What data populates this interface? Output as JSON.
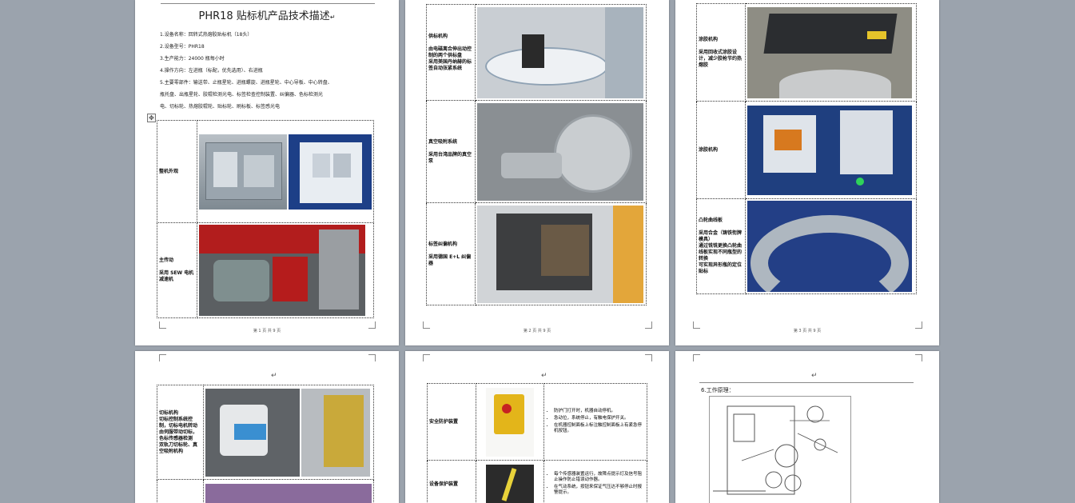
{
  "doc": {
    "title": "PHR18 贴标机产品技术描述",
    "return_mark": "↵",
    "spec_lines": [
      "1.设备名称：回转式热熔胶贴标机（18头）",
      "2.设备型号：PHR18",
      "3.生产能力：24000 瓶每小时",
      "4.操作方向：左进瓶（标配，优先选用）、右进瓶",
      "5.主要零部件：输送带、止瓶星轮、进瓶螺旋、进瓶星轮、中心导板、中心转盘、",
      "瓶托盘、出瓶星轮、胶辊检测光电、标签检查控制装置、纠偏器、色标检测光",
      "电、切标轮、热熔胶辊轮、贴标轮、刷标板、标签感光电"
    ],
    "sections": {
      "p1_r1": "整机外观",
      "p1_r2": "主传动\n\n采用 SEW 电机减速机",
      "p2_r1": "供标机构\n\n由电磁离合伸出动控制的两个供标盘\n采用美国丹纳赫的标签自动张紧系统",
      "p2_r2": "真空吸附系统\n\n采用台湾品牌的真空泵",
      "p2_r3": "标签纠偏机构\n\n采用德国 E+L 纠偏器",
      "p3_r1": "涂胶机构\n\n采用回收式涂胶设计，减少胶枪节约热熔胶",
      "p3_r2": "涂胶机构",
      "p3_r3": "凸轮曲线板\n\n采用合金（铸铁衔牌模具）\n通过铣铣更换凸轮曲线板实现不同瓶型的转换\n可实现异形瓶的定位贴标",
      "p4_r1": "切标机构\n切标控制系统控制，切标电机转动由伺服带动切标，色标传感器检测\n双轨刀切标轮、真空吸附机构",
      "p5_r1": "安全防护装置",
      "p5_r2": "设备保护装置",
      "p6_heading": "6.工作原理："
    },
    "p5_bullets_1": [
      "防护门打开时，机器自动停机。",
      "急动位，系统停止，有触电保护开关。",
      "在机器控制面板上标注触控制面板上有紧急停机按钮。"
    ],
    "p5_bullets_2": [
      "每个传感器装置运行，故障点提示灯及信号阻止操作防止错误动作器。",
      "在气动系统，按钮来保证气压达不够停止时报警提示。"
    ],
    "page_numbers": [
      "第 1 页 共 9 页",
      "第 2 页 共 9 页",
      "第 3 页 共 9 页"
    ]
  }
}
